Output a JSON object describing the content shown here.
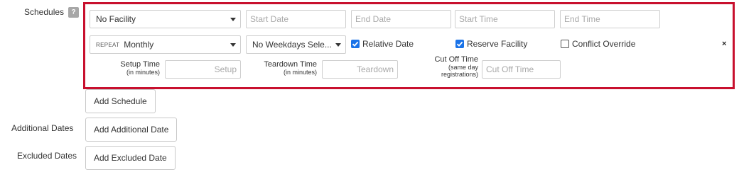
{
  "labels": {
    "schedules": "Schedules",
    "help": "?",
    "additional_dates": "Additional Dates",
    "excluded_dates": "Excluded Dates"
  },
  "schedule": {
    "facility_value": "No Facility",
    "start_date_placeholder": "Start Date",
    "end_date_placeholder": "End Date",
    "start_time_placeholder": "Start Time",
    "end_time_placeholder": "End Time",
    "repeat_tag": "REPEAT",
    "repeat_value": "Monthly",
    "weekdays_value": "No Weekdays Sele...",
    "relative_date_label": "Relative Date",
    "relative_date_checked": true,
    "reserve_facility_label": "Reserve Facility",
    "reserve_facility_checked": true,
    "conflict_override_label": "Conflict Override",
    "conflict_override_checked": false,
    "remove_glyph": "×",
    "setup_time_label": "Setup Time",
    "setup_time_sub": "(in minutes)",
    "setup_placeholder": "Setup",
    "teardown_time_label": "Teardown Time",
    "teardown_time_sub": "(in minutes)",
    "teardown_placeholder": "Teardown",
    "cutoff_label": "Cut Off Time",
    "cutoff_sub1": "(same day",
    "cutoff_sub2": "registrations)",
    "cutoff_placeholder": "Cut Off Time"
  },
  "buttons": {
    "add_schedule": "Add Schedule",
    "add_additional_date": "Add Additional Date",
    "add_excluded_date": "Add Excluded Date"
  },
  "colors": {
    "panel_border": "#c8102e",
    "checkbox_checked": "#1a73e8"
  }
}
